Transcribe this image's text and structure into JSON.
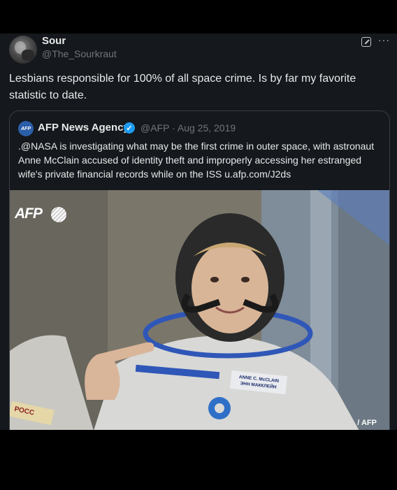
{
  "post": {
    "author_name": "Sour",
    "author_handle": "@The_Sourkraut",
    "more_label": "···",
    "text": "Lesbians responsible for 100% of all space crime. Is by far my favorite statistic to date."
  },
  "quote": {
    "avatar_text": "AFP",
    "author_name": "AFP News Agency",
    "verified_mark": "✓",
    "meta": "@AFP · Aug 25, 2019",
    "text": ".@NASA is investigating what may be the first crime in outer space, with astronaut Anne McClain accused of identity theft and improperly accessing her estranged wife's private financial records while on the ISS u.afp.com/J2ds",
    "media": {
      "logo_text": "AFP",
      "credit": "/ AFP",
      "nametag_line1": "ANNE C. McCLAIN",
      "nametag_line2": "ЭНН МАККЛЕЙН",
      "patch_text": "РОСС"
    }
  },
  "colors": {
    "background": "#000000",
    "post_bg": "#15181c",
    "text": "#e7e9ea",
    "muted": "#71767b",
    "verified": "#1d9bf0"
  }
}
